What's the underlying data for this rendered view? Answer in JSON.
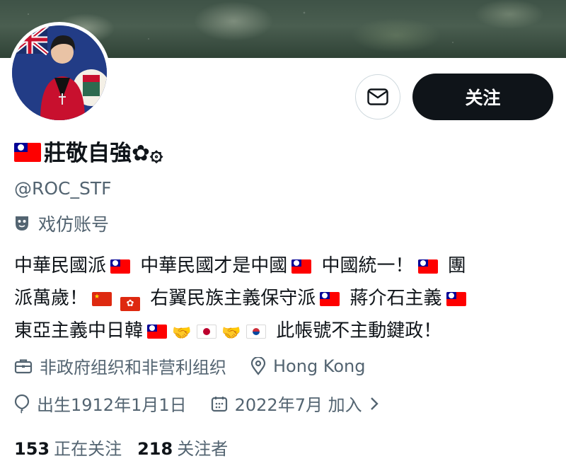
{
  "profile": {
    "display_name": "莊敬自強✿۞",
    "handle": "@ROC_STF",
    "parody_label": "戏仿账号",
    "bio_lines": [
      [
        "中華民國派",
        "flag-tw",
        " 中華民國才是中國",
        "flag-tw",
        " 中國統一！",
        "flag-tw",
        " 團"
      ],
      [
        "派萬歲！",
        "flag-cn",
        "flag-hk",
        " 右翼民族主義保守派",
        "flag-tw",
        " 蔣介石主義",
        "flag-tw"
      ],
      [
        "東亞主義中日韓",
        "flag-tw",
        "handshake",
        "flag-jp",
        "handshake",
        "flag-kr",
        " 此帳號不主動鍵政！"
      ]
    ],
    "category": "非政府组织和非营利组织",
    "location": "Hong Kong",
    "birth": "出生1912年1月1日",
    "joined": "2022年7月 加入",
    "following_count": "153",
    "following_label": "正在关注",
    "followers_count": "218",
    "followers_label": "关注者"
  },
  "actions": {
    "follow_label": "关注"
  },
  "colors": {
    "primary_text": "#0f1419",
    "secondary_text": "#536471",
    "button_dark": "#0f1419",
    "border": "#cfd9de"
  },
  "icons": [
    "mail-icon",
    "parody-mask-icon",
    "briefcase-icon",
    "location-pin-icon",
    "balloon-icon",
    "calendar-icon",
    "chevron-right-icon",
    "handshake-icon"
  ]
}
